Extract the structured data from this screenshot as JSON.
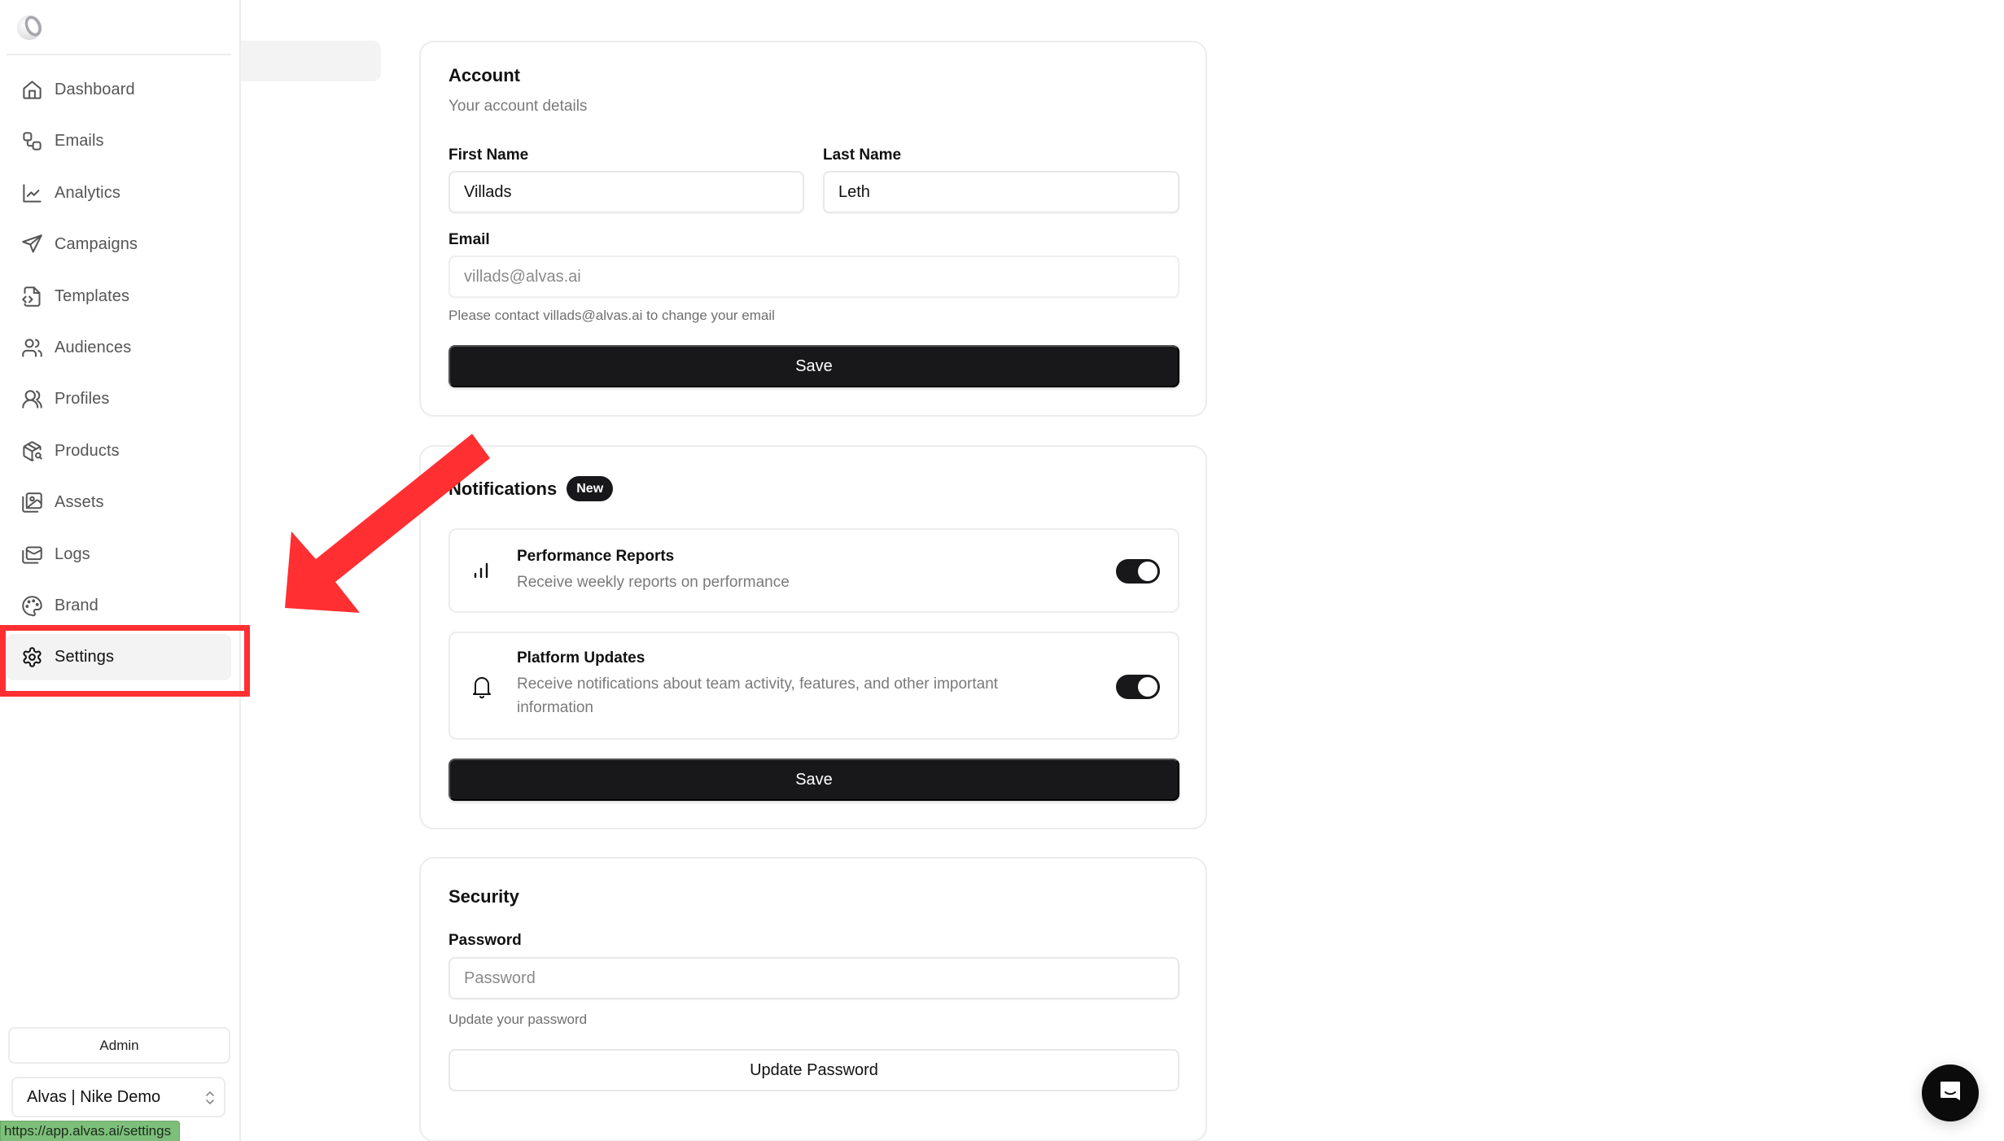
{
  "sidebar": {
    "logo": "alvas-logo",
    "items": [
      {
        "label": "Dashboard",
        "icon": "home-icon",
        "active": false
      },
      {
        "label": "Emails",
        "icon": "workflow-icon",
        "active": false
      },
      {
        "label": "Analytics",
        "icon": "line-chart-icon",
        "active": false
      },
      {
        "label": "Campaigns",
        "icon": "send-icon",
        "active": false
      },
      {
        "label": "Templates",
        "icon": "file-code-icon",
        "active": false
      },
      {
        "label": "Audiences",
        "icon": "users-icon",
        "active": false
      },
      {
        "label": "Profiles",
        "icon": "user-round-icon",
        "active": false
      },
      {
        "label": "Products",
        "icon": "package-search-icon",
        "active": false
      },
      {
        "label": "Assets",
        "icon": "images-icon",
        "active": false
      },
      {
        "label": "Logs",
        "icon": "mails-icon",
        "active": false
      },
      {
        "label": "Brand",
        "icon": "palette-icon",
        "active": false
      },
      {
        "label": "Settings",
        "icon": "gear-icon",
        "active": true
      }
    ],
    "admin_label": "Admin",
    "workspace": {
      "selected": "Alvas | Nike Demo"
    }
  },
  "status_bar": {
    "url": "https://app.alvas.ai/settings"
  },
  "account": {
    "title": "Account",
    "subtitle": "Your account details",
    "first_name": {
      "label": "First Name",
      "value": "Villads"
    },
    "last_name": {
      "label": "Last Name",
      "value": "Leth"
    },
    "email": {
      "label": "Email",
      "placeholder": "villads@alvas.ai",
      "help": "Please contact villads@alvas.ai to change your email"
    },
    "save_label": "Save"
  },
  "notifications": {
    "title": "Notifications",
    "badge": "New",
    "items": [
      {
        "title": "Performance Reports",
        "description": "Receive weekly reports on performance",
        "icon": "bar-chart-icon",
        "enabled": true
      },
      {
        "title": "Platform Updates",
        "description": "Receive notifications about team activity, features, and other important information",
        "icon": "bell-icon",
        "enabled": true
      }
    ],
    "save_label": "Save"
  },
  "security": {
    "title": "Security",
    "password": {
      "label": "Password",
      "placeholder": "Password",
      "help": "Update your password"
    },
    "update_label": "Update Password"
  },
  "chat": {
    "icon": "chat-icon"
  },
  "annotation": {
    "color": "#ff2f32",
    "target": "Settings"
  },
  "colors": {
    "primary": "#18181a",
    "muted_text": "#7a7a7a",
    "border": "#ececec",
    "annotation": "#ff2f32"
  }
}
